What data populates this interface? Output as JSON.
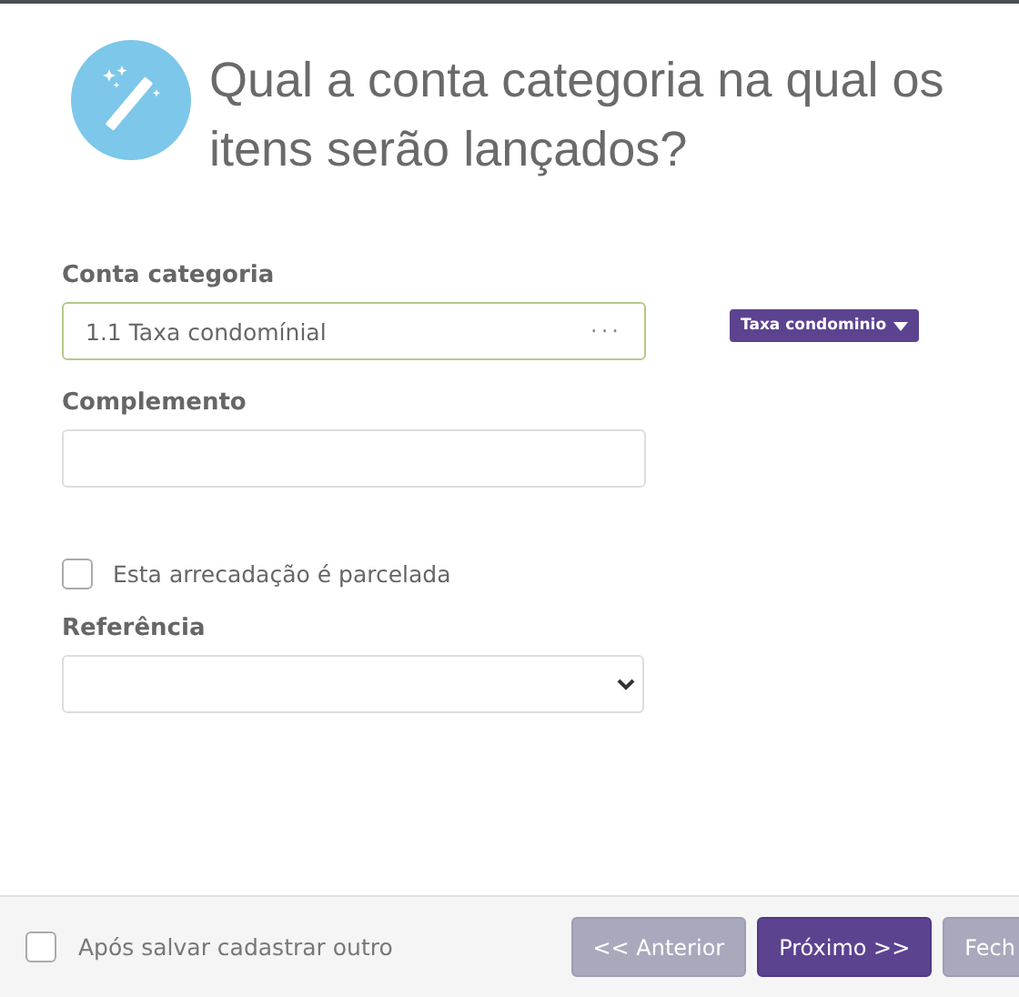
{
  "header": {
    "title": "Qual a conta categoria na qual os itens serão lançados?"
  },
  "form": {
    "conta_categoria": {
      "label": "Conta categoria",
      "value": "1.1 Taxa condomínial",
      "more": "···",
      "tag": "Taxa condominio"
    },
    "complemento": {
      "label": "Complemento"
    },
    "parcelada": {
      "label": "Esta arrecadação é parcelada",
      "checked": false
    },
    "referencia": {
      "label": "Referência"
    }
  },
  "footer": {
    "save_another": {
      "label": "Após salvar cadastrar outro",
      "checked": false
    },
    "buttons": [
      {
        "label": "<< Anterior",
        "disabled": true
      },
      {
        "label": "Próximo >>",
        "disabled": false
      },
      {
        "label": "Fech",
        "disabled": true
      }
    ]
  }
}
